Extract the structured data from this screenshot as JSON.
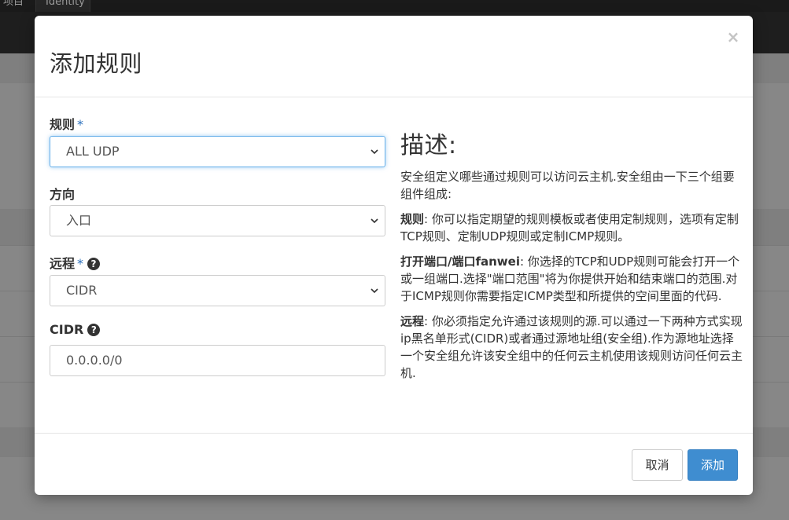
{
  "background": {
    "tabs": [
      "项目",
      "Identity"
    ]
  },
  "modal": {
    "title": "添加规则",
    "close_label": "×",
    "fields": {
      "rule": {
        "label": "规则",
        "required_mark": "*",
        "value": "ALL UDP"
      },
      "direction": {
        "label": "方向",
        "value": "入口"
      },
      "remote": {
        "label": "远程",
        "required_mark": "*",
        "value": "CIDR"
      },
      "cidr": {
        "label": "CIDR",
        "value": "0.0.0.0/0"
      }
    },
    "help_icon_glyph": "?",
    "description": {
      "title": "描述:",
      "intro": "安全组定义哪些通过规则可以访问云主机.安全组由一下三个组要组件组成:",
      "rule_term": "规则",
      "rule_text": ": 你可以指定期望的规则模板或者使用定制规则，选项有定制TCP规则、定制UDP规则或定制ICMP规则。",
      "port_term": "打开端口/端口fanwei",
      "port_text": ": 你选择的TCP和UDP规则可能会打开一个或一组端口.选择\"端口范围\"将为你提供开始和结束端口的范围.对于ICMP规则你需要指定ICMP类型和所提供的空间里面的代码.",
      "remote_term": "远程",
      "remote_text": ": 你必须指定允许通过该规则的源.可以通过一下两种方式实现ip黑名单形式(CIDR)或者通过源地址组(安全组).作为源地址选择一个安全组允许该安全组中的任何云主机使用该规则访问任何云主机."
    },
    "footer": {
      "cancel_label": "取消",
      "add_label": "添加"
    }
  },
  "colors": {
    "primary": "#3f8dd0",
    "focus": "#66afe9",
    "required": "#2a6ebb"
  }
}
